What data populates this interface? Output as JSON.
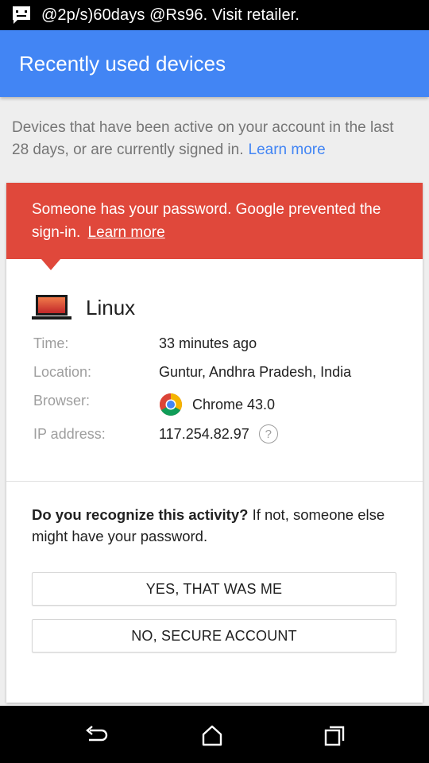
{
  "status_bar": {
    "notification_icon": "message-icon",
    "text": "@2p/s)60days @Rs96. Visit retailer."
  },
  "app_bar": {
    "title": "Recently used devices",
    "color": "#4285f4"
  },
  "intro": {
    "text": "Devices that have been active on your account in the last 28 days, or are currently signed in.",
    "link": "Learn more"
  },
  "alert": {
    "text": "Someone has your password. Google prevented the sign-in.",
    "link": "Learn more",
    "color": "#e0483b"
  },
  "device": {
    "icon": "laptop-icon",
    "name": "Linux",
    "details": [
      {
        "label": "Time:",
        "value": "33 minutes ago"
      },
      {
        "label": "Location:",
        "value": "Guntur, Andhra Pradesh, India"
      },
      {
        "label": "Browser:",
        "value": "Chrome 43.0",
        "icon": "chrome-icon"
      },
      {
        "label": "IP address:",
        "value": "117.254.82.97",
        "icon": "help-icon",
        "help": "?"
      }
    ]
  },
  "question": {
    "bold": "Do you recognize this activity?",
    "text": "If not, someone else might have your password."
  },
  "buttons": {
    "yes": "YES, THAT WAS ME",
    "no": "NO, SECURE ACCOUNT"
  },
  "nav_bar": {
    "back": "back-icon",
    "home": "home-icon",
    "recents": "recents-icon"
  }
}
